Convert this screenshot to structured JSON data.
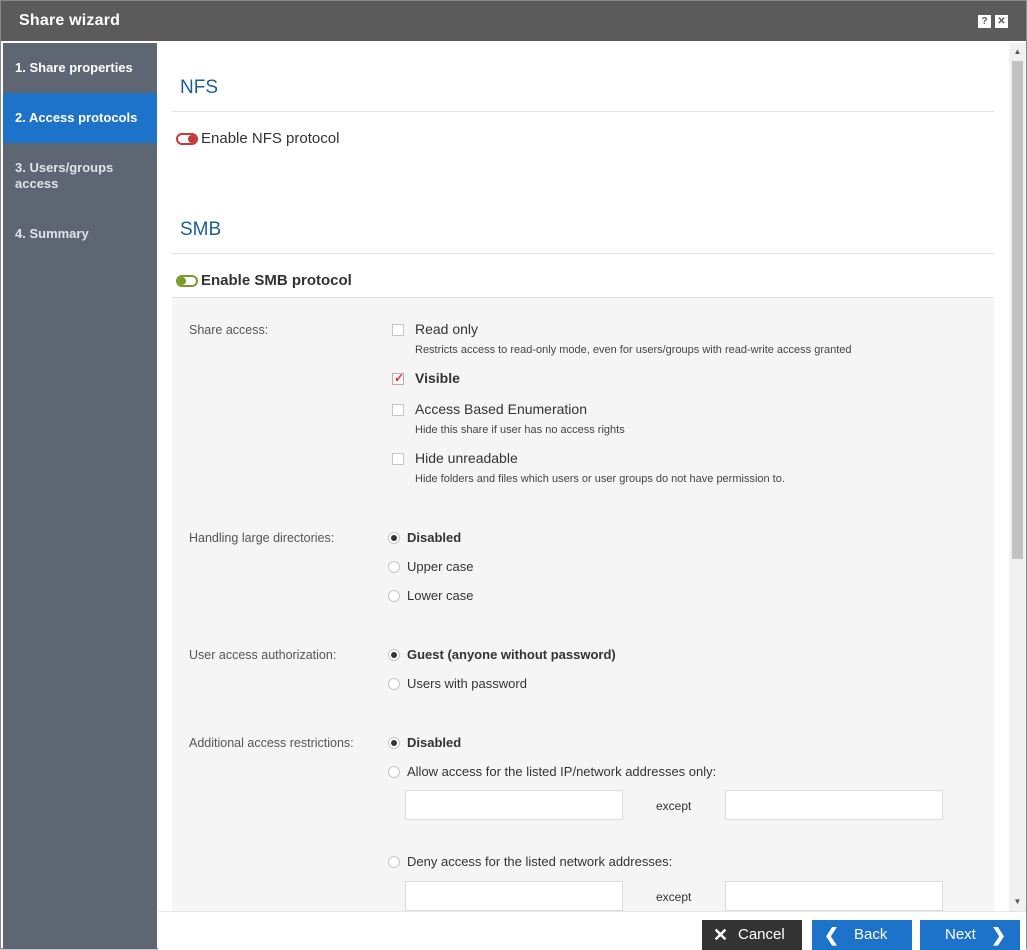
{
  "window": {
    "title": "Share wizard",
    "help_icon": "?",
    "close_icon": "✕"
  },
  "sidebar": {
    "items": [
      {
        "label": "1. Share properties"
      },
      {
        "label": "2. Access protocols"
      },
      {
        "label": "3. Users/groups access"
      },
      {
        "label": "4. Summary"
      }
    ],
    "active_index": 1
  },
  "nfs": {
    "title": "NFS",
    "toggle_label": "Enable NFS protocol",
    "enabled": false
  },
  "smb": {
    "title": "SMB",
    "toggle_label": "Enable SMB protocol",
    "enabled": true,
    "share_access": {
      "label": "Share access:",
      "options": [
        {
          "label": "Read only",
          "description": "Restricts access to read-only mode, even for users/groups with read-write access granted",
          "checked": false
        },
        {
          "label": "Visible",
          "description": "",
          "checked": true
        },
        {
          "label": "Access Based Enumeration",
          "description": "Hide this share if user has no access rights",
          "checked": false
        },
        {
          "label": "Hide unreadable",
          "description": "Hide folders and files which users or user groups do not have permission to.",
          "checked": false
        }
      ]
    },
    "large_dirs": {
      "label": "Handling large directories:",
      "options": [
        {
          "label": "Disabled",
          "checked": true
        },
        {
          "label": "Upper case",
          "checked": false
        },
        {
          "label": "Lower case",
          "checked": false
        }
      ]
    },
    "user_auth": {
      "label": "User access authorization:",
      "options": [
        {
          "label": "Guest (anyone without password)",
          "checked": true
        },
        {
          "label": "Users with password",
          "checked": false
        }
      ]
    },
    "additional": {
      "label": "Additional access restrictions:",
      "options": [
        {
          "label": "Disabled",
          "checked": true
        },
        {
          "label": "Allow access for the listed IP/network addresses only:",
          "checked": false
        },
        {
          "label": "Deny access for the listed network addresses:",
          "checked": false
        }
      ],
      "except_label": "except",
      "allow_value": "",
      "allow_except_value": "",
      "deny_value": "",
      "deny_except_value": ""
    }
  },
  "footer": {
    "cancel_label": "Cancel",
    "back_label": "Back",
    "next_label": "Next",
    "colors": {
      "cancel": "#333333",
      "primary": "#1c73c9"
    }
  }
}
